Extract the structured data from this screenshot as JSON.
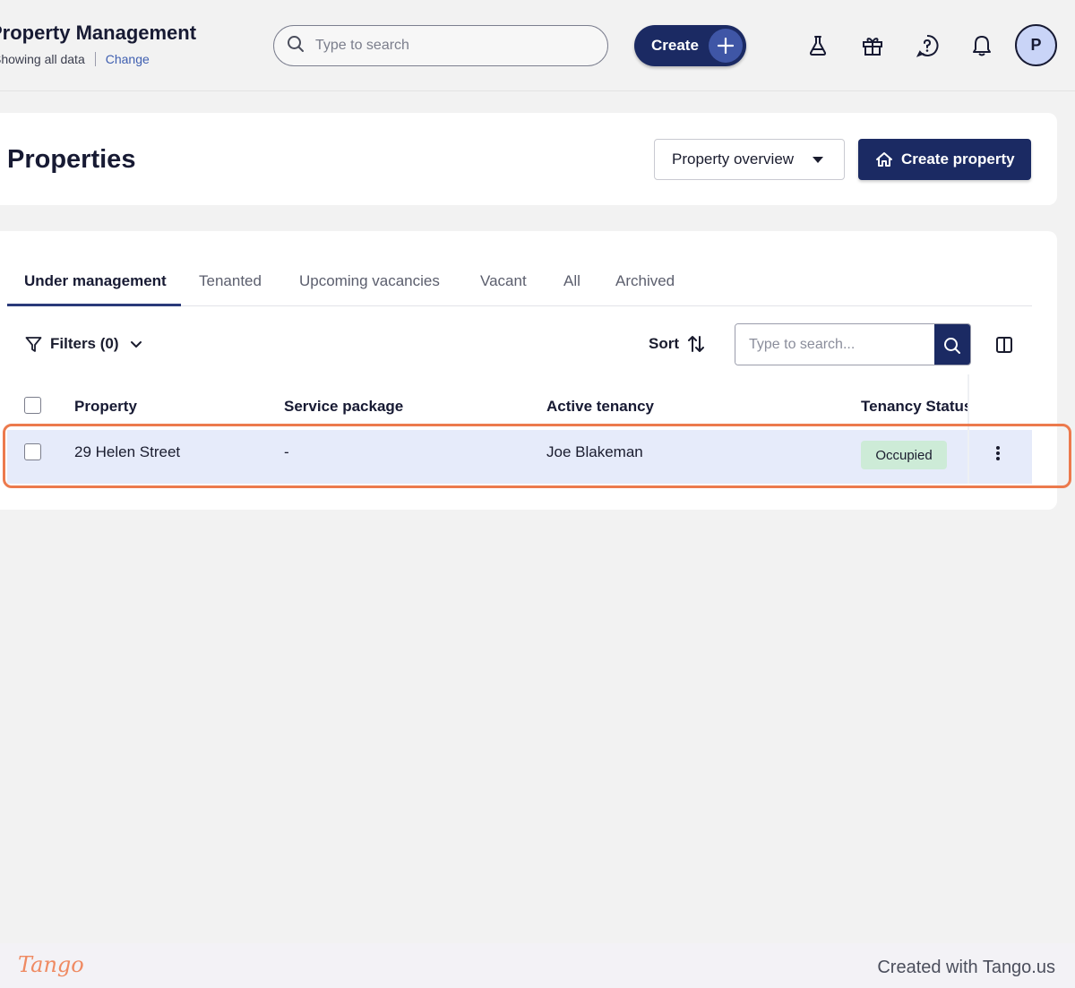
{
  "header": {
    "app_title": "Property Management",
    "subline_text": "Showing all data",
    "change_link": "Change",
    "search_placeholder": "Type to search",
    "create_label": "Create",
    "avatar_initial": "P"
  },
  "page": {
    "title": "Properties",
    "overview_label": "Property overview",
    "create_property_label": "Create property"
  },
  "tabs": [
    {
      "label": "Under management",
      "active": true
    },
    {
      "label": "Tenanted"
    },
    {
      "label": "Upcoming vacancies"
    },
    {
      "label": "Vacant"
    },
    {
      "label": "All"
    },
    {
      "label": "Archived"
    }
  ],
  "toolbar": {
    "filters_label": "Filters (0)",
    "sort_label": "Sort",
    "search_placeholder": "Type to search..."
  },
  "table": {
    "columns": [
      "Property",
      "Service package",
      "Active tenancy",
      "Tenancy Status"
    ],
    "rows": [
      {
        "property": "29 Helen Street",
        "service_package": "-",
        "active_tenancy": "Joe Blakeman",
        "status": "Occupied"
      }
    ]
  },
  "footer": {
    "logo_text": "Tango",
    "credit": "Created with Tango.us"
  },
  "colors": {
    "primary": "#1b2a63",
    "highlight": "#ec7a4d",
    "status_occupied": "#cdebd7",
    "row_selected": "#e6ebfa"
  }
}
